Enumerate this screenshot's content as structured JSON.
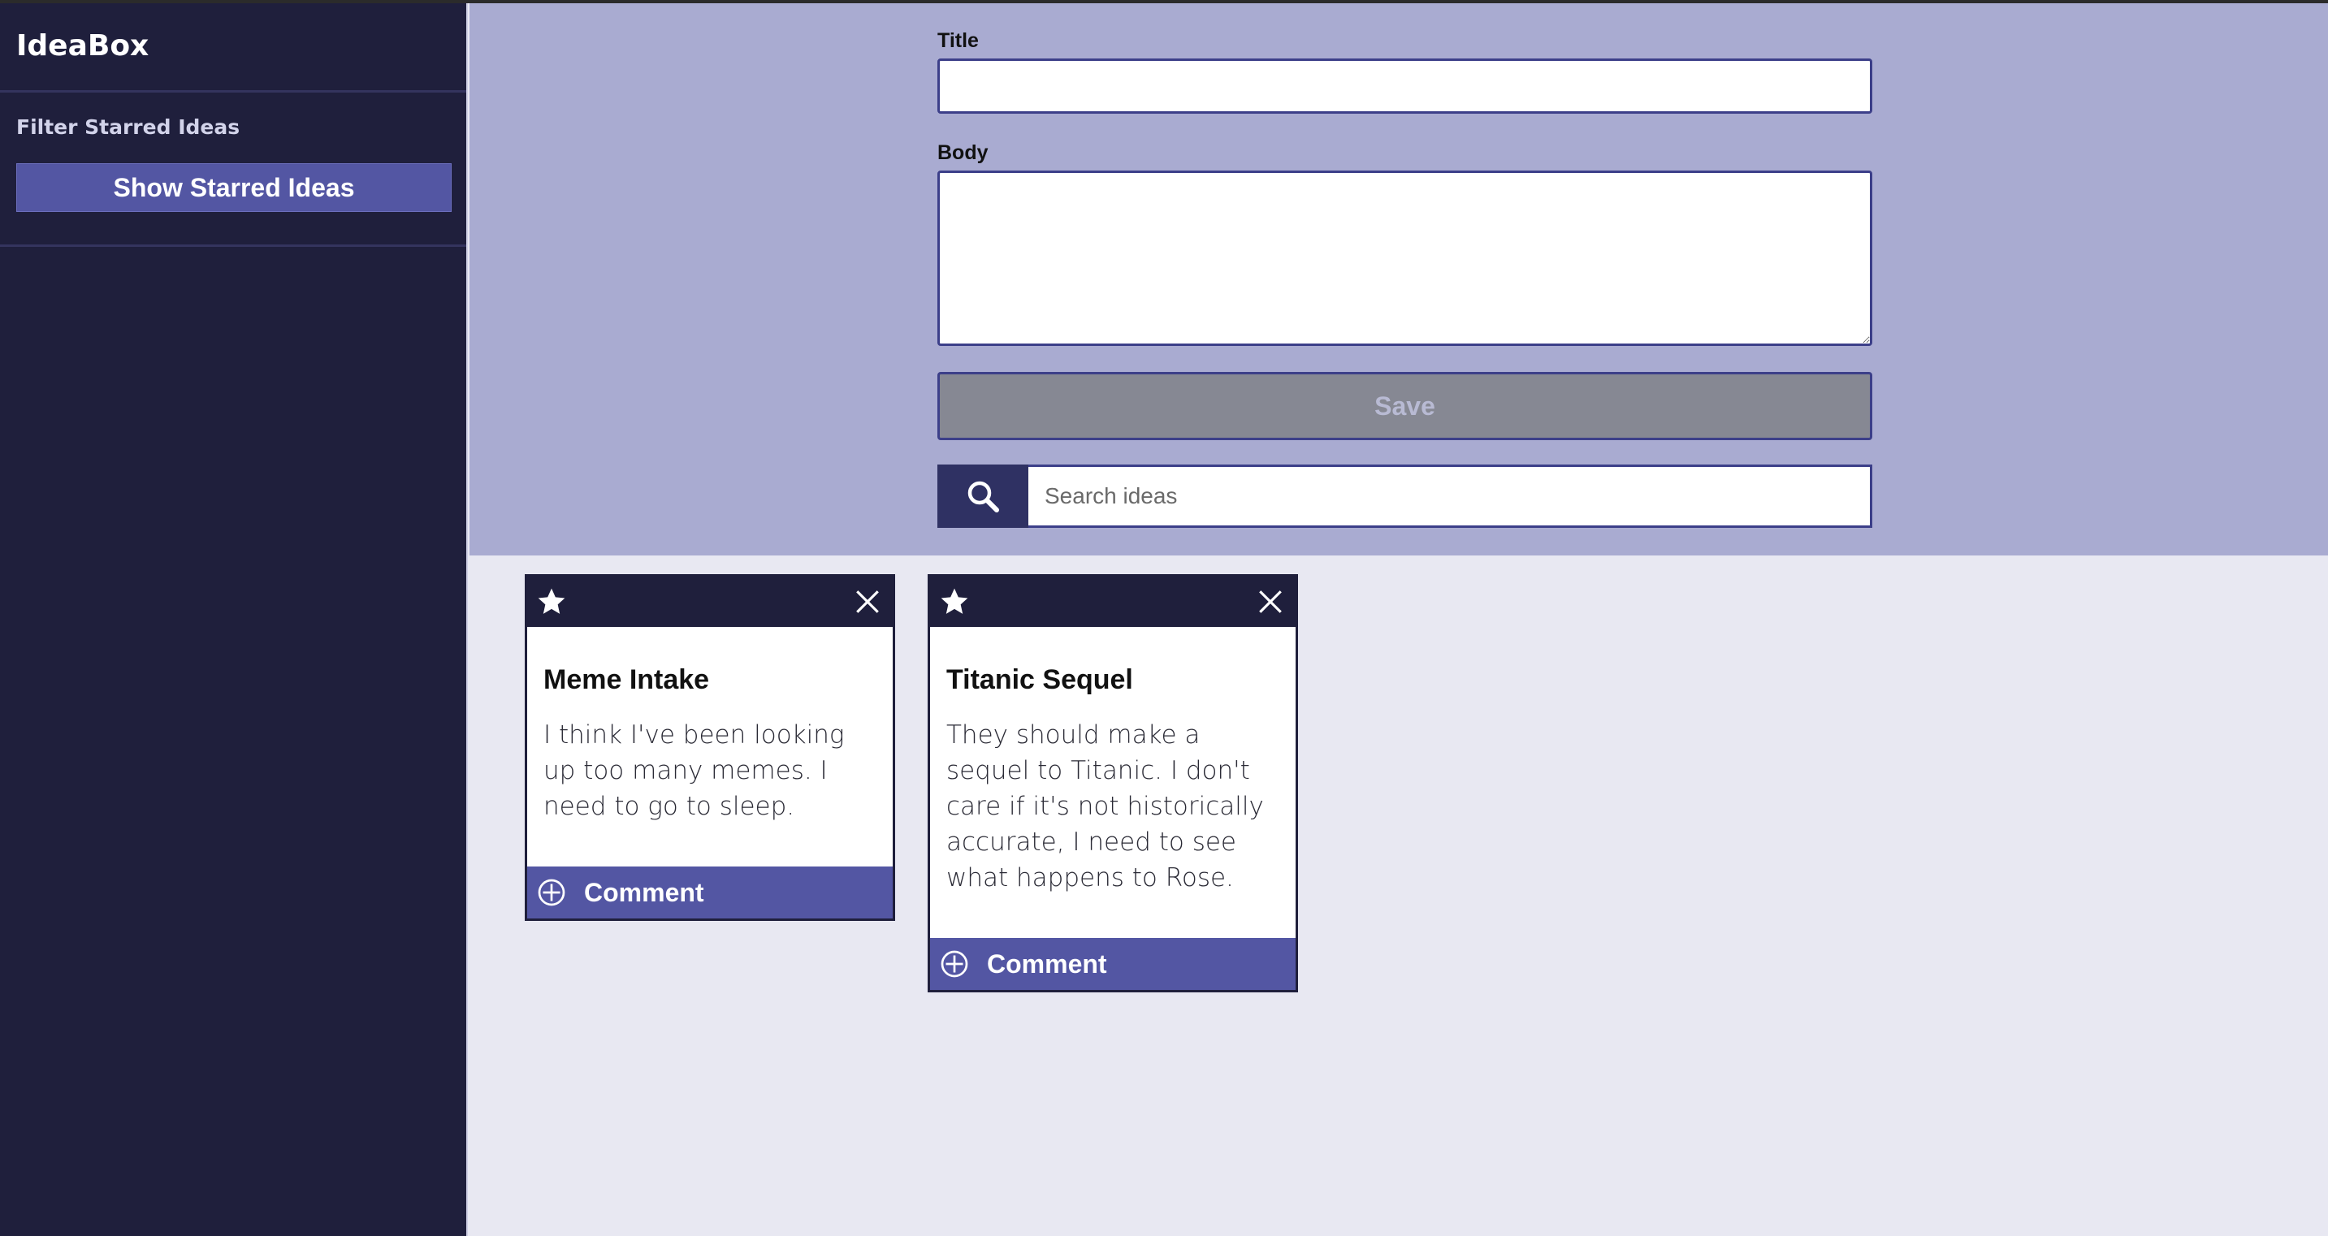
{
  "app": {
    "title": "IdeaBox"
  },
  "sidebar": {
    "filter_label": "Filter Starred Ideas",
    "show_starred_label": "Show Starred Ideas"
  },
  "form": {
    "title_label": "Title",
    "title_value": "",
    "body_label": "Body",
    "body_value": "",
    "save_label": "Save",
    "search_placeholder": "Search ideas",
    "search_value": ""
  },
  "ideas": [
    {
      "title": "Meme Intake",
      "body": "I think I've been looking up too many memes. I need to go to sleep.",
      "comment_label": "Comment",
      "icons": {
        "star": "star-icon",
        "delete": "close-icon",
        "comment": "plus-circle-icon"
      }
    },
    {
      "title": "Titanic Sequel",
      "body": "They should make a sequel to Titanic. I don't care if it's not historically accurate, I need to see what happens to Rose.",
      "comment_label": "Comment",
      "icons": {
        "star": "star-icon",
        "delete": "close-icon",
        "comment": "plus-circle-icon"
      }
    }
  ],
  "colors": {
    "sidebar_bg": "#1f1f3c",
    "accent": "#5356a3",
    "form_bg": "#a9abd1",
    "main_bg": "#e8e8f2",
    "save_disabled": "#868893"
  }
}
